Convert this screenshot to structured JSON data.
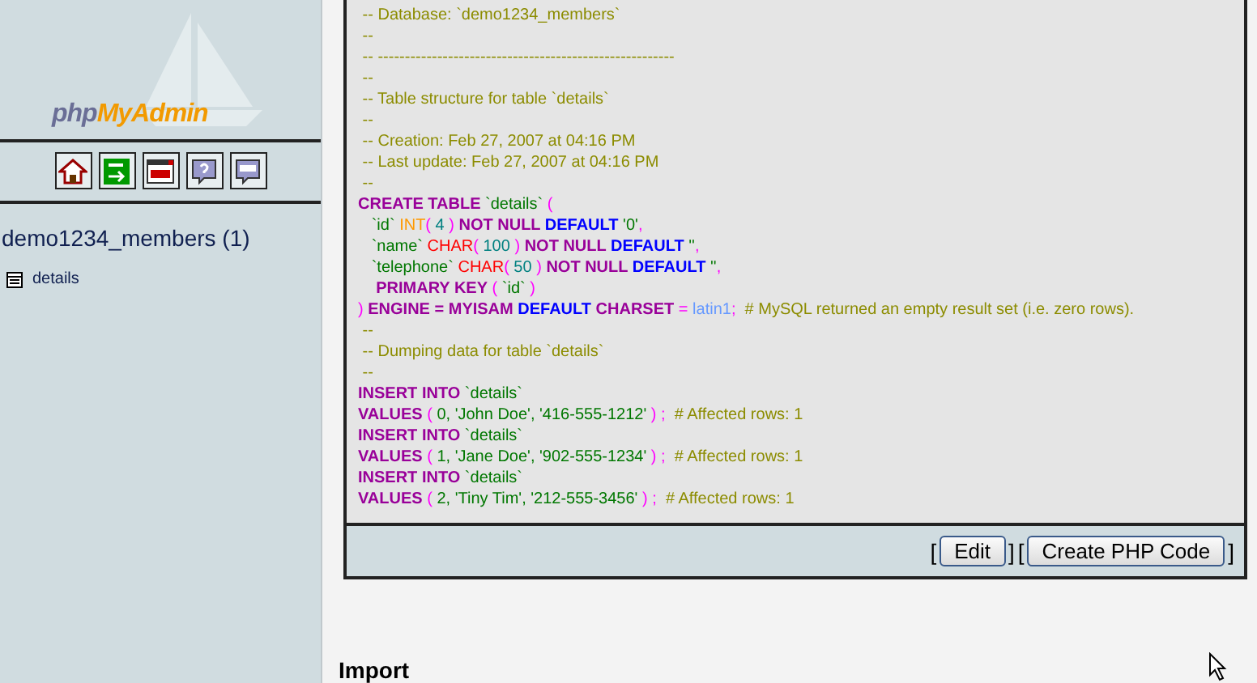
{
  "sidebar": {
    "logo": {
      "part_1": "php",
      "part_2": "MyAdmin"
    },
    "toolbar": [
      {
        "kind": "home"
      },
      {
        "kind": "exit"
      },
      {
        "kind": "sql_window"
      },
      {
        "kind": "help"
      },
      {
        "kind": "sql_query"
      }
    ],
    "database": "demo1234_members (1)",
    "tables": [
      {
        "name": "details"
      }
    ]
  },
  "sql_dump": {
    "lines": [
      [
        {
          "kind": "comment",
          "text": " -- Database: `demo1234_members`"
        }
      ],
      [
        {
          "kind": "comment",
          "text": " --"
        }
      ],
      [
        {
          "kind": "comment",
          "text": " -- -------------------------------------------------------"
        }
      ],
      [
        {
          "kind": "comment",
          "text": " --"
        }
      ],
      [
        {
          "kind": "comment",
          "text": " -- Table structure for table `details`"
        }
      ],
      [
        {
          "kind": "comment",
          "text": " --"
        }
      ],
      [
        {
          "kind": "comment",
          "text": " -- Creation: Feb 27, 2007 at 04:16 PM"
        }
      ],
      [
        {
          "kind": "comment",
          "text": " -- Last update: Feb 27, 2007 at 04:16 PM"
        }
      ],
      [
        {
          "kind": "comment",
          "text": " --"
        }
      ],
      [
        {
          "kind": "keyword",
          "text": "CREATE TABLE"
        },
        {
          "kind": "string",
          "text": " `details`"
        },
        {
          "kind": "punct",
          "text": " ("
        }
      ],
      [
        {
          "kind": "string",
          "text": "   `id` "
        },
        {
          "kind": "int",
          "text": "INT"
        },
        {
          "kind": "punct",
          "text": "( "
        },
        {
          "kind": "number",
          "text": "4"
        },
        {
          "kind": "punct",
          "text": " ) "
        },
        {
          "kind": "keyword",
          "text": "NOT NULL"
        },
        {
          "kind": "default",
          "text": " DEFAULT"
        },
        {
          "kind": "string",
          "text": " '0'"
        },
        {
          "kind": "punct",
          "text": ","
        }
      ],
      [
        {
          "kind": "string",
          "text": "   `name` "
        },
        {
          "kind": "char",
          "text": "CHAR"
        },
        {
          "kind": "punct",
          "text": "( "
        },
        {
          "kind": "number",
          "text": "100"
        },
        {
          "kind": "punct",
          "text": " ) "
        },
        {
          "kind": "keyword",
          "text": "NOT NULL"
        },
        {
          "kind": "default",
          "text": " DEFAULT"
        },
        {
          "kind": "string",
          "text": " ''"
        },
        {
          "kind": "punct",
          "text": ","
        }
      ],
      [
        {
          "kind": "string",
          "text": "   `telephone` "
        },
        {
          "kind": "char",
          "text": "CHAR"
        },
        {
          "kind": "punct",
          "text": "( "
        },
        {
          "kind": "number",
          "text": "50"
        },
        {
          "kind": "punct",
          "text": " ) "
        },
        {
          "kind": "keyword",
          "text": "NOT NULL"
        },
        {
          "kind": "default",
          "text": " DEFAULT"
        },
        {
          "kind": "string",
          "text": " ''"
        },
        {
          "kind": "punct",
          "text": ","
        }
      ],
      [
        {
          "kind": "keyword",
          "text": "    PRIMARY KEY"
        },
        {
          "kind": "punct",
          "text": " ( "
        },
        {
          "kind": "string",
          "text": "`id`"
        },
        {
          "kind": "punct",
          "text": " )"
        }
      ],
      [
        {
          "kind": "punct",
          "text": ")"
        },
        {
          "kind": "keyword",
          "text": " ENGINE = MYISAM"
        },
        {
          "kind": "default",
          "text": " DEFAULT"
        },
        {
          "kind": "keyword",
          "text": " CHARSET"
        },
        {
          "kind": "punct",
          "text": " = "
        },
        {
          "kind": "value",
          "text": "latin1"
        },
        {
          "kind": "punct",
          "text": ";"
        },
        {
          "kind": "comment",
          "text": "  # MySQL returned an empty result set (i.e. zero rows)."
        }
      ],
      [
        {
          "kind": "comment",
          "text": " --"
        }
      ],
      [
        {
          "kind": "comment",
          "text": " -- Dumping data for table `details`"
        }
      ],
      [
        {
          "kind": "comment",
          "text": " --"
        }
      ],
      [
        {
          "kind": "keyword",
          "text": "INSERT INTO"
        },
        {
          "kind": "string",
          "text": " `details`"
        }
      ],
      [
        {
          "kind": "keyword",
          "text": "VALUES"
        },
        {
          "kind": "punct",
          "text": " ( "
        },
        {
          "kind": "string",
          "text": "0, 'John Doe', '416-555-1212'"
        },
        {
          "kind": "punct",
          "text": " ) ;"
        },
        {
          "kind": "comment",
          "text": "  # Affected rows: 1"
        }
      ],
      [
        {
          "kind": "keyword",
          "text": "INSERT INTO"
        },
        {
          "kind": "string",
          "text": " `details`"
        }
      ],
      [
        {
          "kind": "keyword",
          "text": "VALUES"
        },
        {
          "kind": "punct",
          "text": " ( "
        },
        {
          "kind": "string",
          "text": "1, 'Jane Doe', '902-555-1234'"
        },
        {
          "kind": "punct",
          "text": " ) ;"
        },
        {
          "kind": "comment",
          "text": "  # Affected rows: 1"
        }
      ],
      [
        {
          "kind": "keyword",
          "text": "INSERT INTO"
        },
        {
          "kind": "string",
          "text": " `details`"
        }
      ],
      [
        {
          "kind": "keyword",
          "text": "VALUES"
        },
        {
          "kind": "punct",
          "text": " ( "
        },
        {
          "kind": "string",
          "text": "2, 'Tiny Tim', '212-555-3456'"
        },
        {
          "kind": "punct",
          "text": " ) ;"
        },
        {
          "kind": "comment",
          "text": "  # Affected rows: 1"
        }
      ]
    ]
  },
  "action_bar": [
    {
      "kind": "bracket",
      "text": "["
    },
    {
      "kind": "button",
      "text": "Edit"
    },
    {
      "kind": "bracket",
      "text": "]"
    },
    {
      "kind": "bracket",
      "text": "["
    },
    {
      "kind": "button",
      "text": "Create PHP Code"
    },
    {
      "kind": "bracket",
      "text": "]"
    }
  ],
  "section_heading": "Import"
}
